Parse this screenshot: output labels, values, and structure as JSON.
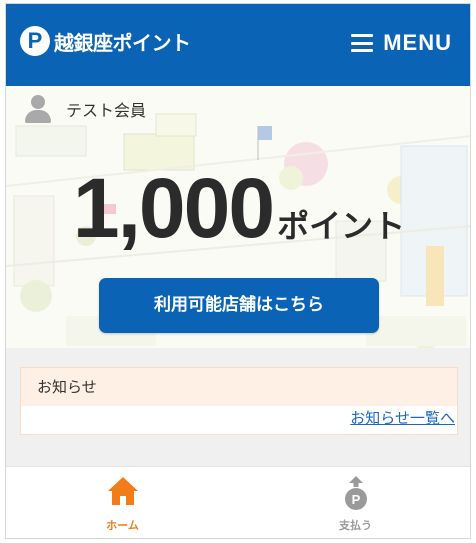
{
  "header": {
    "logo_letter": "P",
    "logo_text": "越銀座ポイント",
    "menu_label": "MENU"
  },
  "member": {
    "name": "テスト会員"
  },
  "points": {
    "value": "1,000",
    "unit": "ポイント"
  },
  "stores_button": {
    "label": "利用可能店舗はこちら"
  },
  "notice": {
    "title": "お知らせ",
    "link_label": "お知らせ一覧へ"
  },
  "tabs": [
    {
      "label": "ホーム",
      "icon": "home-icon",
      "active": true
    },
    {
      "label": "支払う",
      "icon": "pay-icon",
      "active": false
    }
  ],
  "colors": {
    "brand": "#0a63b5",
    "active_tab": "#f07c1a",
    "inactive_tab": "#9a9a9a",
    "notice_bg": "#fff0e6"
  }
}
